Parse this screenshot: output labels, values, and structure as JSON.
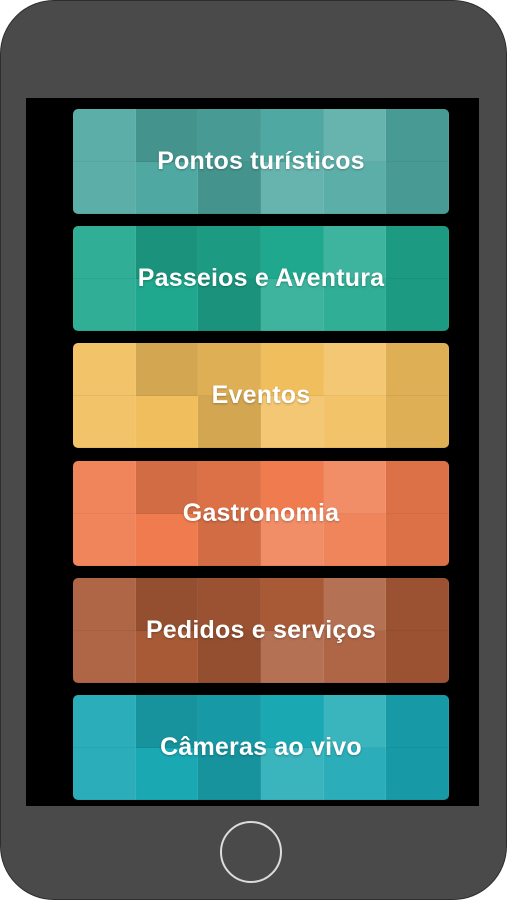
{
  "menu": {
    "items": [
      {
        "label": "Pontos turísticos",
        "color": "#4fa8a1"
      },
      {
        "label": "Passeios e Aventura",
        "color": "#1fa88e"
      },
      {
        "label": "Eventos",
        "color": "#f1be5d"
      },
      {
        "label": "Gastronomia",
        "color": "#ef7b4e"
      },
      {
        "label": "Pedidos e serviços",
        "color": "#a85a37"
      },
      {
        "label": "Câmeras ao vivo",
        "color": "#1aa8b3"
      }
    ]
  },
  "device": {
    "frame_color": "#4a4a4a",
    "screen_color": "#000000"
  }
}
